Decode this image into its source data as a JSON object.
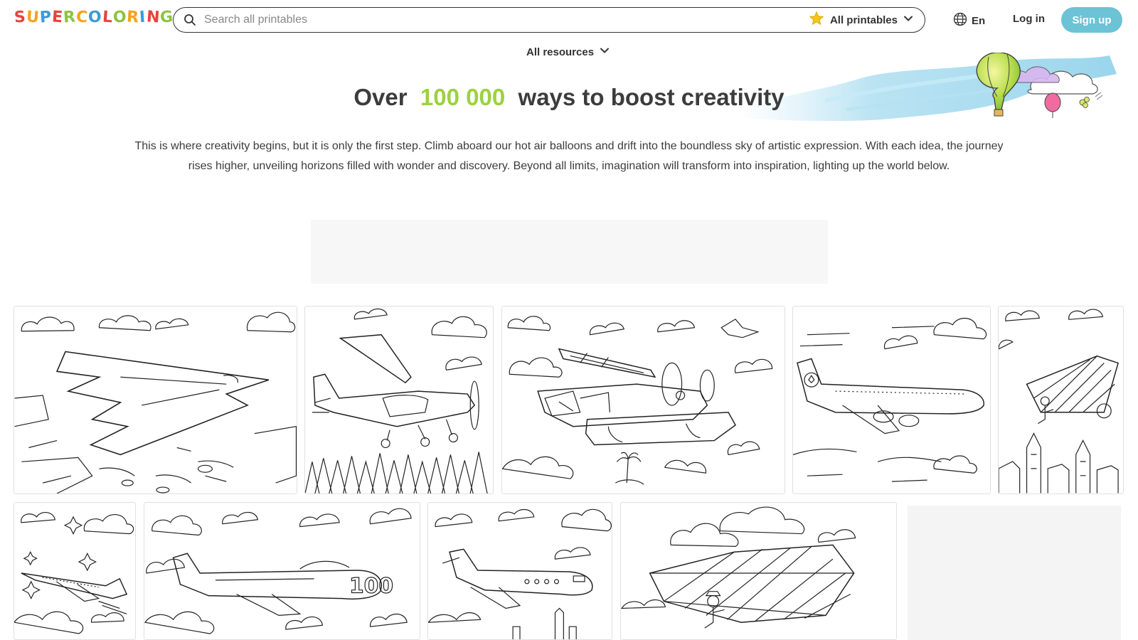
{
  "header": {
    "logo_text": "SUPERCOLORING",
    "logo_letters": [
      {
        "ch": "S",
        "color": "#e8433b"
      },
      {
        "ch": "U",
        "color": "#f6a21d"
      },
      {
        "ch": "P",
        "color": "#3c9ad6"
      },
      {
        "ch": "E",
        "color": "#e8433b"
      },
      {
        "ch": "R",
        "color": "#8bc53f"
      },
      {
        "ch": "C",
        "color": "#f6a21d"
      },
      {
        "ch": "O",
        "color": "#3c9ad6"
      },
      {
        "ch": "L",
        "color": "#e8433b"
      },
      {
        "ch": "O",
        "color": "#8bc53f"
      },
      {
        "ch": "R",
        "color": "#f6a21d"
      },
      {
        "ch": "I",
        "color": "#3c9ad6"
      },
      {
        "ch": "N",
        "color": "#e8433b"
      },
      {
        "ch": "G",
        "color": "#8bc53f"
      }
    ],
    "search": {
      "placeholder": "Search all printables",
      "value": "",
      "scope_label": "All printables",
      "scope_icon": "star-icon"
    },
    "language_label": "En",
    "login_label": "Log in",
    "signup_label": "Sign up"
  },
  "resources_menu": {
    "label": "All resources"
  },
  "hero": {
    "title_before": "Over",
    "title_highlight": "100 000",
    "title_after": "ways to boost creativity",
    "description": "This is where creativity begins, but it is only the first step. Climb aboard our hot air balloons and drift into the boundless sky of artistic expression. With each idea, the journey rises higher, unveiling horizons filled with wonder and discovery. Beyond all limits, imagination will transform into inspiration, lighting up the world below."
  },
  "gallery": {
    "items": [
      {
        "name": "stealth-bomber-over-canyon"
      },
      {
        "name": "cessna-over-forest"
      },
      {
        "name": "seaplane-with-pelican"
      },
      {
        "name": "lufthansa-jumbo-jet"
      },
      {
        "name": "ornithopter-over-town"
      },
      {
        "name": "concorde-among-stars"
      },
      {
        "name": "jet-fighter-100"
      },
      {
        "name": "business-jet-over-city"
      },
      {
        "name": "da-vinci-flying-machine"
      }
    ]
  },
  "colors": {
    "accent_green": "#9bd240",
    "signup_blue": "#6cc3d5",
    "text_dark": "#3c3c3c"
  }
}
